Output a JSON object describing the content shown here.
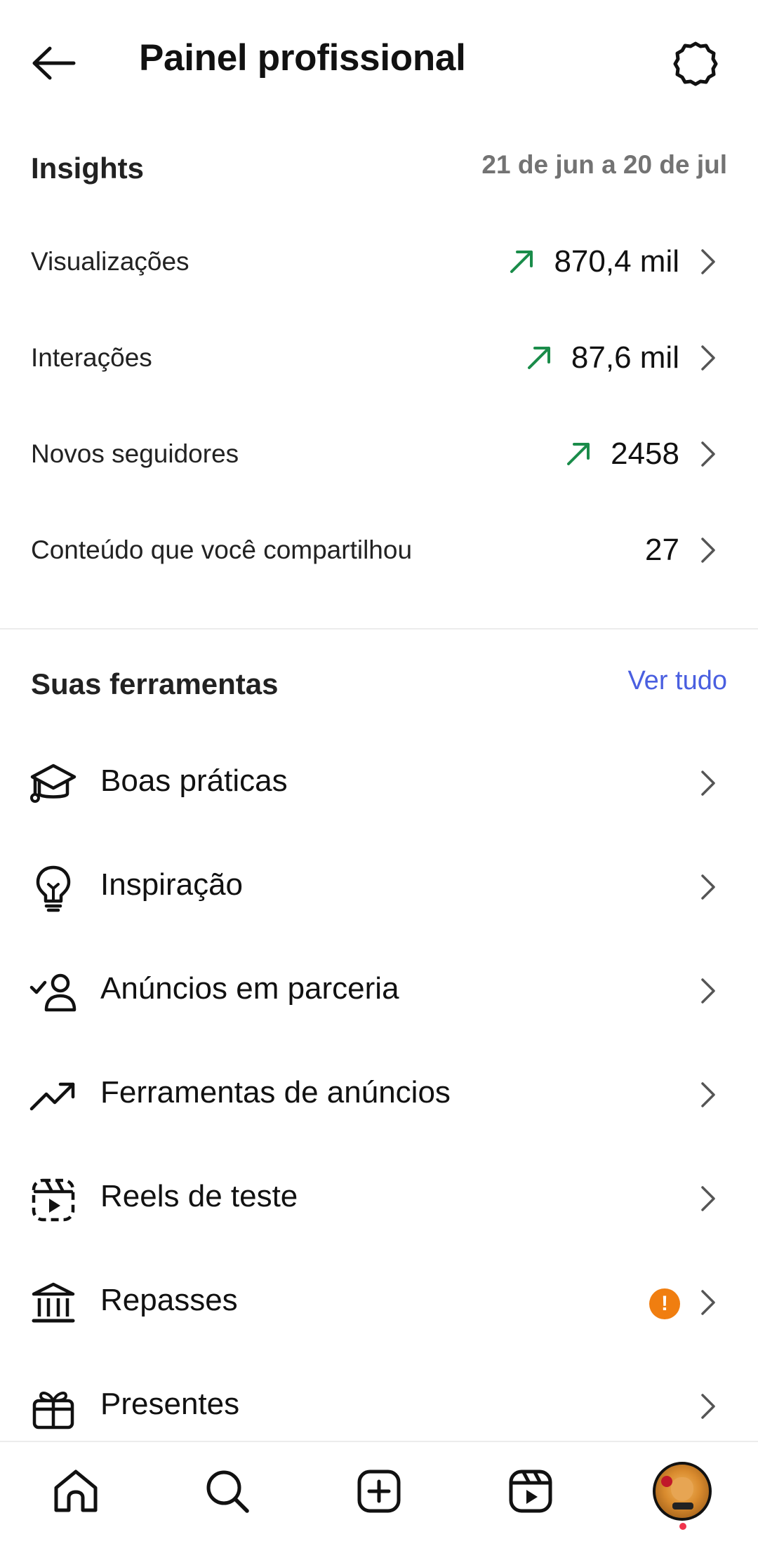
{
  "header": {
    "title": "Painel profissional",
    "back_icon": "arrow-left-icon",
    "settings_icon": "gear-icon"
  },
  "insights": {
    "title": "Insights",
    "date_range": "21 de jun a 20 de jul",
    "metrics": [
      {
        "label": "Visualizações",
        "value": "870,4 mil",
        "trend": "up"
      },
      {
        "label": "Interações",
        "value": "87,6 mil",
        "trend": "up"
      },
      {
        "label": "Novos seguidores",
        "value": "2458",
        "trend": "up"
      },
      {
        "label": "Conteúdo que você compartilhou",
        "value": "27",
        "trend": "none"
      }
    ]
  },
  "tools": {
    "title": "Suas ferramentas",
    "see_all": "Ver tudo",
    "items": [
      {
        "label": "Boas práticas",
        "icon": "graduation-cap-icon"
      },
      {
        "label": "Inspiração",
        "icon": "lightbulb-icon"
      },
      {
        "label": "Anúncios em parceria",
        "icon": "partner-check-icon"
      },
      {
        "label": "Ferramentas de anúncios",
        "icon": "trending-up-icon"
      },
      {
        "label": "Reels de teste",
        "icon": "reels-trial-icon"
      },
      {
        "label": "Repasses",
        "icon": "bank-icon",
        "badge": "!"
      },
      {
        "label": "Presentes",
        "icon": "gift-icon"
      }
    ]
  },
  "bottom_nav": {
    "items": [
      "home-icon",
      "search-icon",
      "create-icon",
      "reels-icon",
      "profile-avatar"
    ]
  },
  "colors": {
    "trend_up": "#1a8c4a",
    "link": "#4a5fe0",
    "badge": "#f07e10",
    "notification_dot": "#f0344d"
  }
}
